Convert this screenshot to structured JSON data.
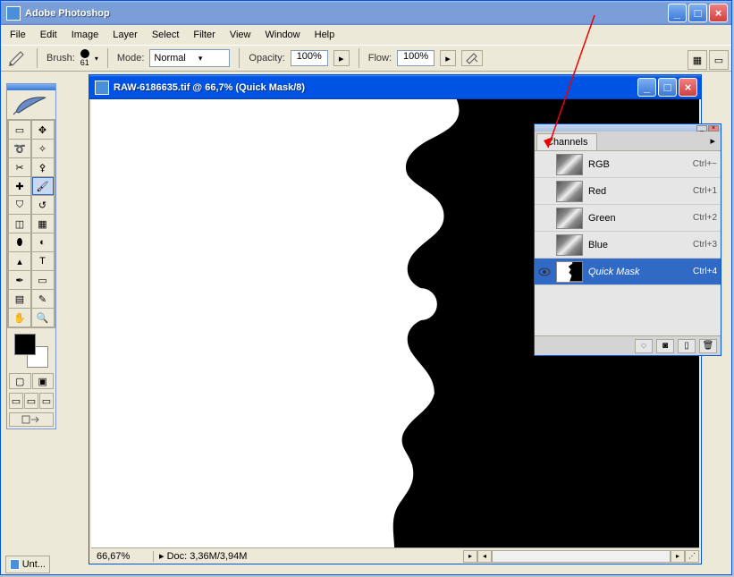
{
  "main_window": {
    "title": "Adobe Photoshop"
  },
  "menu": [
    "File",
    "Edit",
    "Image",
    "Layer",
    "Select",
    "Filter",
    "View",
    "Window",
    "Help"
  ],
  "optbar": {
    "brush_label": "Brush:",
    "brush_size": "61",
    "mode_label": "Mode:",
    "mode_value": "Normal",
    "opacity_label": "Opacity:",
    "opacity_value": "100%",
    "flow_label": "Flow:",
    "flow_value": "100%"
  },
  "doc": {
    "title": "RAW-6186635.tif @ 66,7% (Quick Mask/8)",
    "zoom": "66,67%",
    "info": "Doc: 3,36M/3,94M"
  },
  "channels": {
    "tab": "Channels",
    "rows": [
      {
        "name": "RGB",
        "short": "Ctrl+~",
        "eye": false,
        "thumb": "flower"
      },
      {
        "name": "Red",
        "short": "Ctrl+1",
        "eye": false,
        "thumb": "flower"
      },
      {
        "name": "Green",
        "short": "Ctrl+2",
        "eye": false,
        "thumb": "flower"
      },
      {
        "name": "Blue",
        "short": "Ctrl+3",
        "eye": false,
        "thumb": "flower"
      },
      {
        "name": "Quick Mask",
        "short": "Ctrl+4",
        "eye": true,
        "sel": true,
        "thumb": "mask"
      }
    ]
  },
  "taskbar": {
    "label": "Unt..."
  }
}
